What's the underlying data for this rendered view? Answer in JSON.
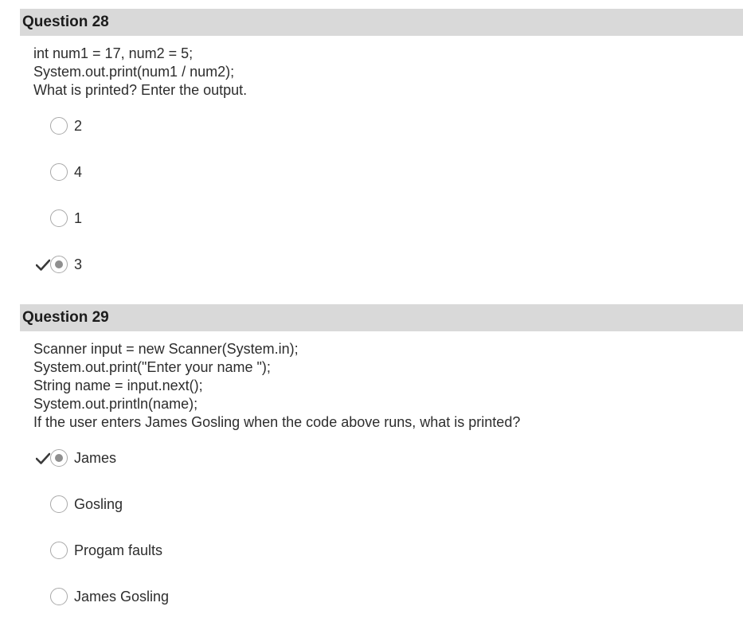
{
  "questions": [
    {
      "title": "Question 28",
      "prompt_lines": [
        "int num1 = 17, num2 = 5;",
        "System.out.print(num1 / num2);",
        "What is printed? Enter the output."
      ],
      "options": [
        {
          "label": "2",
          "selected": false,
          "correct_marker": false
        },
        {
          "label": "4",
          "selected": false,
          "correct_marker": false
        },
        {
          "label": "1",
          "selected": false,
          "correct_marker": false
        },
        {
          "label": "3",
          "selected": true,
          "correct_marker": true
        }
      ]
    },
    {
      "title": "Question 29",
      "prompt_lines": [
        "Scanner input = new Scanner(System.in);",
        "System.out.print(\"Enter your name \");",
        "String name = input.next();",
        "System.out.println(name);",
        "If the user enters James Gosling when the code above runs, what is printed?"
      ],
      "options": [
        {
          "label": "James",
          "selected": true,
          "correct_marker": true
        },
        {
          "label": "Gosling",
          "selected": false,
          "correct_marker": false
        },
        {
          "label": "Progam faults",
          "selected": false,
          "correct_marker": false
        },
        {
          "label": "James Gosling",
          "selected": false,
          "correct_marker": false
        }
      ]
    }
  ],
  "icons": {
    "check": "checkmark-icon"
  },
  "colors": {
    "header_bg": "#d9d9d9",
    "radio_dot": "#8f8f8f",
    "checkmark": "#3a3a3a"
  }
}
